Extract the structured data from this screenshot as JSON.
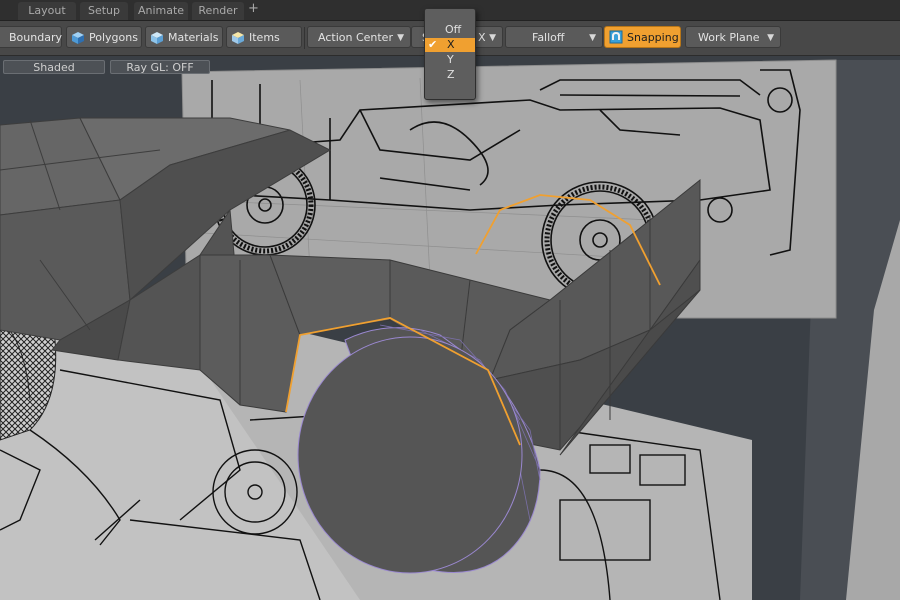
{
  "tabs": [
    {
      "label": "Layout"
    },
    {
      "label": "Setup"
    },
    {
      "label": "Animate"
    },
    {
      "label": "Render"
    }
  ],
  "tab_add": "+",
  "toolbar": {
    "boundary": "Boundary",
    "polygons": "Polygons",
    "materials": "Materials",
    "items": "Items",
    "action_center": "Action Center",
    "symmetry_prefix": "S",
    "symmetry_axis": "X",
    "falloff": "Falloff",
    "snapping": "Snapping",
    "work_plane": "Work Plane"
  },
  "viewport": {
    "shading": "Shaded",
    "raygl": "Ray GL: OFF"
  },
  "axis_dropdown": {
    "options": [
      "Off",
      "X",
      "Y",
      "Z"
    ],
    "selected": "X",
    "check_glyph": "✔"
  },
  "icons": {
    "dropdown_chevron": "chevron-down-icon",
    "cube": "cube-icon",
    "snapping": "magnet-icon"
  },
  "colors": {
    "accent": "#f0a030",
    "toolbar_bg": "#484848",
    "tabbar_bg": "#2f2f2f",
    "viewport_bg": "#3b4046",
    "mesh": "#5b5b5b",
    "selection_edge": "#f0a030",
    "wheel_edge": "#9a88d0"
  }
}
